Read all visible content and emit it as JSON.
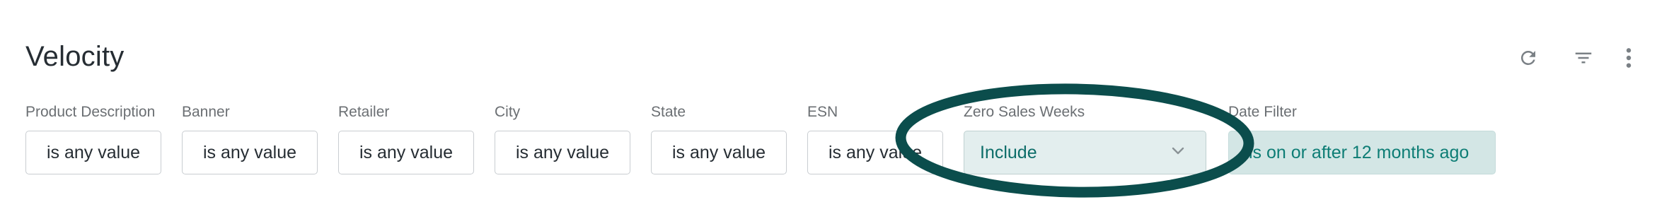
{
  "header": {
    "title": "Velocity",
    "icons": [
      "refresh-icon",
      "filter-icon",
      "more-vert-icon"
    ]
  },
  "filters": [
    {
      "label": "Product Description",
      "value": "is any value"
    },
    {
      "label": "Banner",
      "value": "is any value"
    },
    {
      "label": "Retailer",
      "value": "is any value"
    },
    {
      "label": "City",
      "value": "is any value"
    },
    {
      "label": "State",
      "value": "is any value"
    },
    {
      "label": "ESN",
      "value": "is any value"
    },
    {
      "label": "Zero Sales Weeks",
      "value": "Include"
    },
    {
      "label": "Date Filter",
      "value": "is on or after 12 months ago"
    }
  ],
  "colors": {
    "annotation_ring": "#0b4d4c",
    "active_fill": "#d3e6e5",
    "active_text": "#0d7d75"
  }
}
